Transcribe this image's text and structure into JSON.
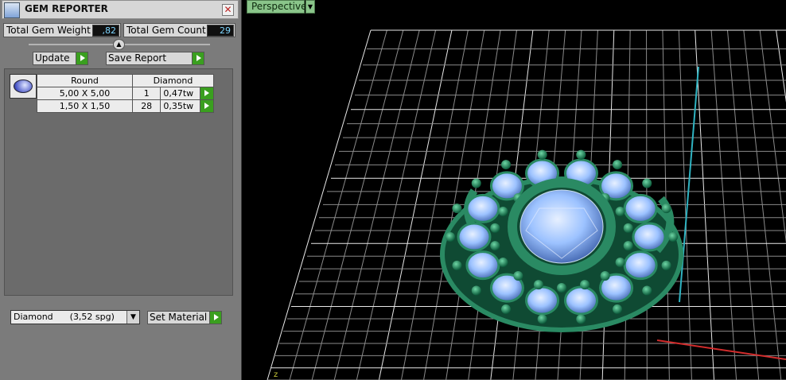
{
  "title": "GEM REPORTER",
  "summary": {
    "weight_label": "Total Gem Weight",
    "weight_value": ",82",
    "count_label": "Total Gem Count",
    "count_value": "29"
  },
  "buttons": {
    "update": "Update",
    "save_report": "Save Report",
    "set_material": "Set Material"
  },
  "table": {
    "headers": [
      "Round",
      "Diamond"
    ],
    "rows": [
      {
        "size": "5,00 X 5,00",
        "count": "1",
        "weight": "0,47tw"
      },
      {
        "size": "1,50 X 1,50",
        "count": "28",
        "weight": "0,35tw"
      }
    ]
  },
  "material": {
    "selected": "Diamond      (3,52 spg)"
  },
  "viewport": {
    "view_label": "Perspective",
    "axis_label": "z"
  },
  "colors": {
    "metal": "#2a8a63",
    "gem": "#9cc2ff",
    "axis_x": "#d22c2c",
    "axis_y": "#2fb3c1",
    "grid": "#cfcfcf"
  }
}
